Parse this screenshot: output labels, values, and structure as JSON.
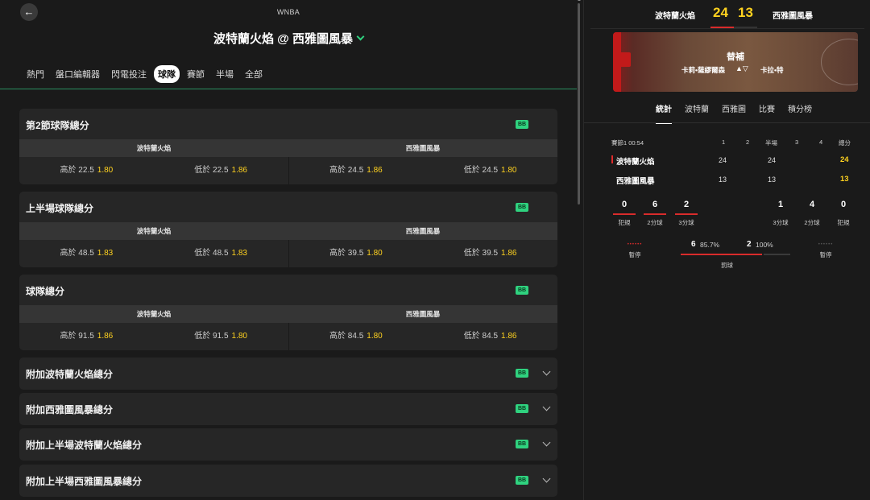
{
  "header": {
    "back_icon": "←",
    "league": "WNBA",
    "title": "波特蘭火焰 @ 西雅圖風暴"
  },
  "tabs": [
    "熱門",
    "盤口編輯器",
    "閃電投注",
    "球隊",
    "賽節",
    "半場",
    "全部"
  ],
  "active_tab": "球隊",
  "badge_text": "BB",
  "accent_color": "#2fd27f",
  "odds_color": "#ffd21f",
  "markets": [
    {
      "title": "第2節球隊總分",
      "teams": [
        "波特蘭火焰",
        "西雅圖風暴"
      ],
      "odds": [
        {
          "label": "高於 22.5",
          "odd": "1.80"
        },
        {
          "label": "低於 22.5",
          "odd": "1.86"
        },
        {
          "label": "高於 24.5",
          "odd": "1.86"
        },
        {
          "label": "低於 24.5",
          "odd": "1.80"
        }
      ]
    },
    {
      "title": "上半場球隊總分",
      "teams": [
        "波特蘭火焰",
        "西雅圖風暴"
      ],
      "odds": [
        {
          "label": "高於 48.5",
          "odd": "1.83"
        },
        {
          "label": "低於 48.5",
          "odd": "1.83"
        },
        {
          "label": "高於 39.5",
          "odd": "1.80"
        },
        {
          "label": "低於 39.5",
          "odd": "1.86"
        }
      ]
    },
    {
      "title": "球隊總分",
      "teams": [
        "波特蘭火焰",
        "西雅圖風暴"
      ],
      "odds": [
        {
          "label": "高於 91.5",
          "odd": "1.86"
        },
        {
          "label": "低於 91.5",
          "odd": "1.80"
        },
        {
          "label": "高於 84.5",
          "odd": "1.80"
        },
        {
          "label": "低於 84.5",
          "odd": "1.86"
        }
      ]
    }
  ],
  "collapsed_markets": [
    "附加波特蘭火焰總分",
    "附加西雅圖風暴總分",
    "附加上半場波特蘭火焰總分",
    "附加上半場西雅圖風暴總分"
  ],
  "scoreboard": {
    "home": "波特蘭火焰",
    "away": "西雅圖風暴",
    "home_score": "24",
    "away_score": "13"
  },
  "court": {
    "label": "替補",
    "player_in": "卡莉•薩繆爾森",
    "arrows": "▲▽",
    "player_out": "卡拉•特"
  },
  "right_tabs": [
    "統計",
    "波特蘭",
    "西雅圖",
    "比賽",
    "積分榜"
  ],
  "right_active_tab": "統計",
  "box": {
    "period": "賽節1 00:54",
    "headers": [
      "1",
      "2",
      "半場",
      "3",
      "4",
      "總分"
    ],
    "rows": [
      {
        "team": "波特蘭火焰",
        "q1": "24",
        "half": "24",
        "total": "24"
      },
      {
        "team": "西雅圖風暴",
        "q1": "13",
        "half": "13",
        "total": "13"
      }
    ]
  },
  "stats": {
    "home": [
      {
        "value": "0",
        "label": "犯規"
      },
      {
        "value": "6",
        "label": "2分球"
      },
      {
        "value": "2",
        "label": "3分球"
      }
    ],
    "away": [
      {
        "value": "1",
        "label": "3分球"
      },
      {
        "value": "4",
        "label": "2分球"
      },
      {
        "value": "0",
        "label": "犯規"
      }
    ],
    "timeout_label": "暫停",
    "timeout_dots": "••••••",
    "ft": {
      "home_made": "6",
      "home_pct": "85.7%",
      "away_made": "2",
      "away_pct": "100%",
      "label": "罰球",
      "home_share": 0.75
    }
  }
}
